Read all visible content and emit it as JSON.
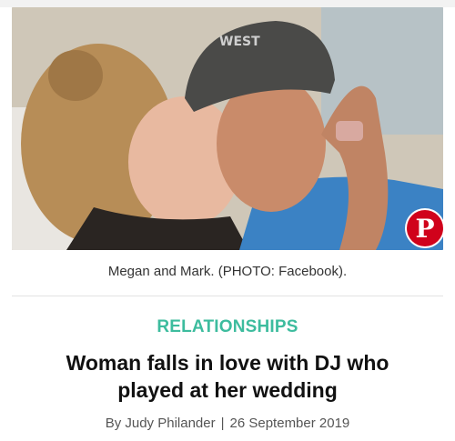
{
  "article": {
    "caption": "Megan and Mark. (PHOTO: Facebook).",
    "category": "RELATIONSHIPS",
    "headline": "Woman falls in love with DJ who played at her wedding",
    "author": "By Judy Philander",
    "separator": "|",
    "date": "26 September 2019"
  },
  "photo": {
    "cap_text": "WEST",
    "pin_label": "P"
  },
  "colors": {
    "category": "#3dbc9e",
    "pinterest": "#d0021b",
    "headline": "#111111"
  }
}
